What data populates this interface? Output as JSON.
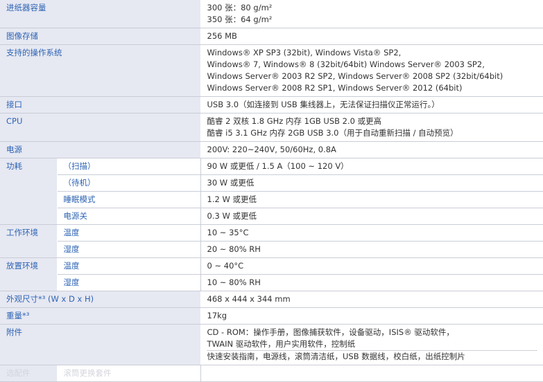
{
  "rows": {
    "feeder": {
      "label": "进纸器容量",
      "lines": [
        "300 张：80 g/m²",
        "350 张：64 g/m²"
      ]
    },
    "image_memory": {
      "label": "图像存储",
      "value": "256 MB"
    },
    "os": {
      "label": "支持的操作系统",
      "lines": [
        "Windows® XP SP3 (32bit), Windows Vista® SP2,",
        "Windows® 7, Windows® 8 (32bit/64bit) Windows Server® 2003 SP2,",
        "Windows Server® 2003 R2 SP2, Windows Server® 2008 SP2 (32bit/64bit)",
        "Windows Server® 2008 R2 SP1, Windows Server® 2012 (64bit)"
      ]
    },
    "interface": {
      "label": "接口",
      "value": "USB 3.0（如连接到 USB 集线器上，无法保证扫描仪正常运行。）"
    },
    "cpu": {
      "label": "CPU",
      "lines": [
        "酷睿 2 双核 1.8 GHz 内存 1GB USB 2.0 或更高",
        "酷睿 i5 3.1 GHz 内存 2GB USB 3.0（用于自动重新扫描 / 自动预览）"
      ]
    },
    "power": {
      "label": "电源",
      "value": "200V: 220~240V, 50/60Hz, 0.8A"
    },
    "consumption": {
      "label": "功耗",
      "items": [
        {
          "sub": "（扫描）",
          "value": "90 W 或更低 / 1.5 A（100 ~ 120 V）"
        },
        {
          "sub": "（待机）",
          "value": "30 W 或更低"
        },
        {
          "sub": "睡眠模式",
          "value": "1.2 W 或更低"
        },
        {
          "sub": "电源关",
          "value": "0.3 W 或更低"
        }
      ]
    },
    "operating_env": {
      "label": "工作环境",
      "items": [
        {
          "sub": "温度",
          "value": "10 ~ 35°C"
        },
        {
          "sub": "湿度",
          "value": "20 ~ 80% RH"
        }
      ]
    },
    "storage_env": {
      "label": "放置环境",
      "items": [
        {
          "sub": "温度",
          "value": "0 ~ 40°C"
        },
        {
          "sub": "湿度",
          "value": "10 ~ 80% RH"
        }
      ]
    },
    "dimensions": {
      "label": "外观尺寸*³ (W x D x H)",
      "value": "468 x 444 x 344 mm"
    },
    "weight": {
      "label": "重量*³",
      "value": "17kg"
    },
    "accessories": {
      "label": "附件",
      "lines": [
        "CD - ROM：操作手册，图像捕获软件，设备驱动，ISIS® 驱动软件，",
        "TWAIN 驱动软件，用户实用软件，控制纸",
        "快速安装指南，电源线，滚筒清洁纸，USB 数据线，校白纸，出纸控制片"
      ]
    },
    "cutoff": {
      "label": "选配件",
      "sub": "滚筒更换套件"
    }
  }
}
